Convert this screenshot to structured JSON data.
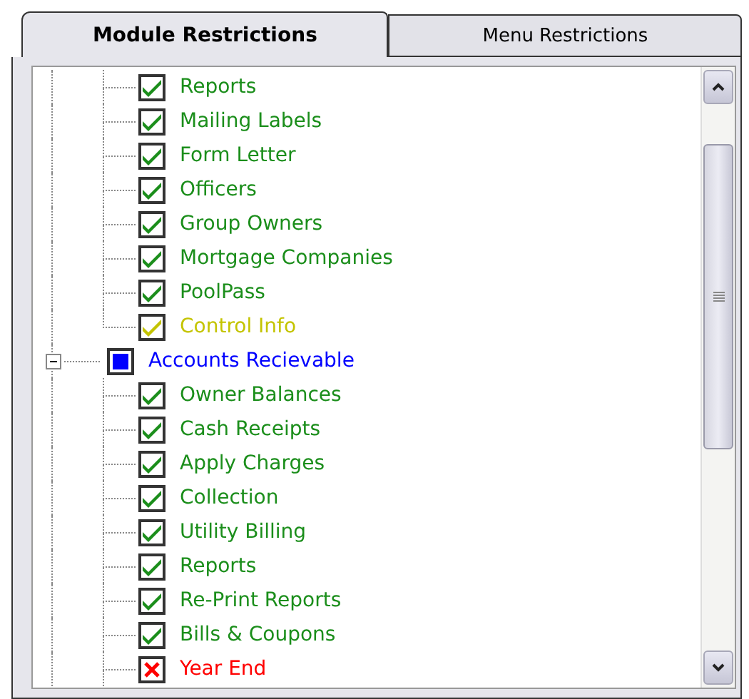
{
  "tabs": [
    {
      "label": "Module Restrictions",
      "selected": true
    },
    {
      "label": "Menu Restrictions",
      "selected": false
    }
  ],
  "tree": [
    {
      "items": [
        {
          "label": "Reports",
          "kind": "checked"
        },
        {
          "label": "Mailing Labels",
          "kind": "checked"
        },
        {
          "label": "Form Letter",
          "kind": "checked"
        },
        {
          "label": "Officers",
          "kind": "checked"
        },
        {
          "label": "Group Owners",
          "kind": "checked"
        },
        {
          "label": "Mortgage Companies",
          "kind": "checked"
        },
        {
          "label": "PoolPass",
          "kind": "checked"
        },
        {
          "label": "Control Info",
          "kind": "limited"
        }
      ]
    },
    {
      "label": "Accounts Recievable",
      "kind": "partial",
      "expanded": true,
      "items": [
        {
          "label": "Owner Balances",
          "kind": "checked"
        },
        {
          "label": "Cash Receipts",
          "kind": "checked"
        },
        {
          "label": "Apply Charges",
          "kind": "checked"
        },
        {
          "label": "Collection",
          "kind": "checked"
        },
        {
          "label": "Utility Billing",
          "kind": "checked"
        },
        {
          "label": "Reports",
          "kind": "checked"
        },
        {
          "label": "Re-Print Reports",
          "kind": "checked"
        },
        {
          "label": "Bills & Coupons",
          "kind": "checked"
        },
        {
          "label": "Year End",
          "kind": "denied"
        }
      ]
    }
  ]
}
